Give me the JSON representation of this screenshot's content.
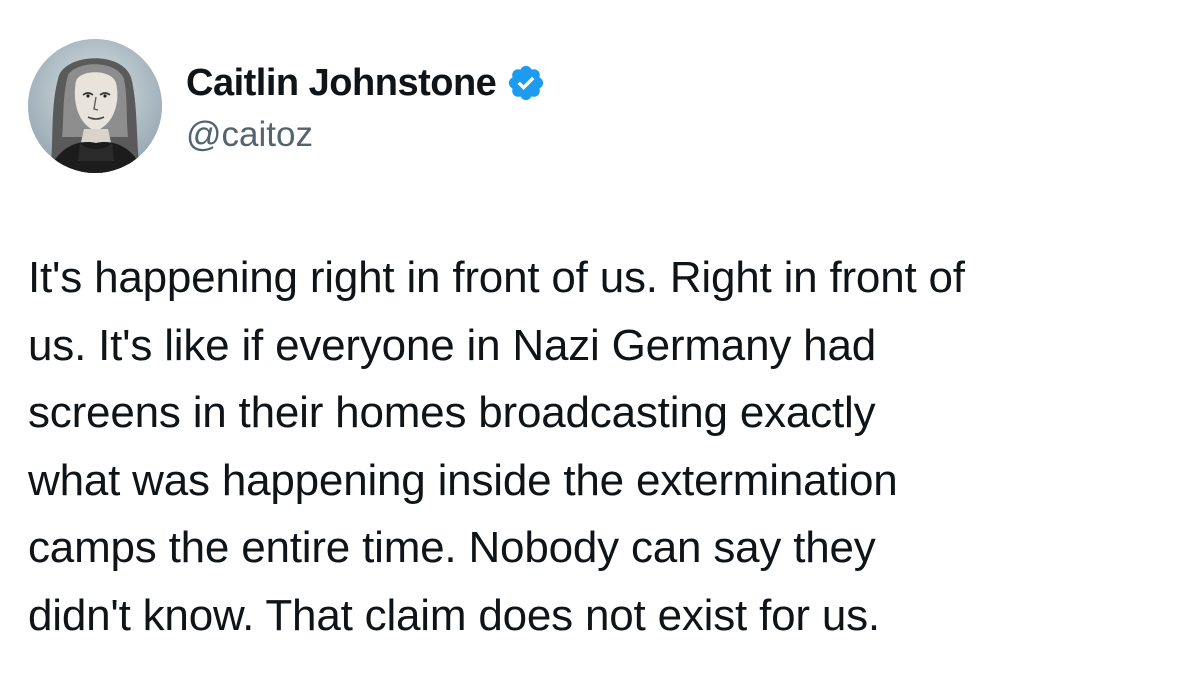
{
  "author": {
    "display_name": "Caitlin Johnstone",
    "handle": "@caitoz",
    "verified": true,
    "verified_badge_color": "#1d9bf0"
  },
  "tweet": {
    "text_lines": [
      "It's happening right in front of us. Right in front of",
      "us. It's like if everyone in Nazi Germany had",
      "screens in their homes broadcasting exactly",
      "what was happening inside the extermination",
      "camps the entire time. Nobody can say they",
      "didn't know. That claim does not exist for us."
    ]
  },
  "icons": {
    "avatar": "profile-avatar",
    "verified": "verified-badge-icon"
  },
  "colors": {
    "text": "#0f1419",
    "secondary_text": "#536471",
    "background": "#ffffff"
  }
}
